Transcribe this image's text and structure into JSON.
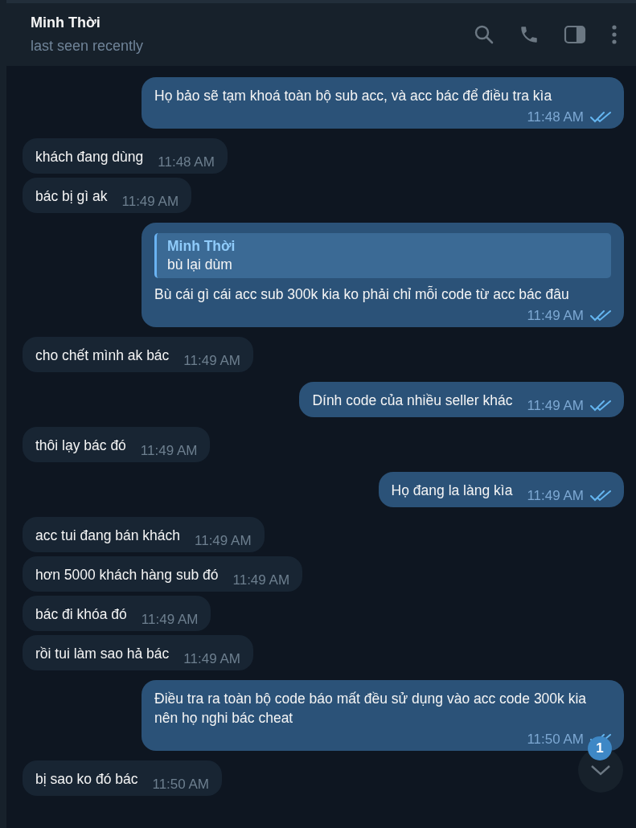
{
  "header": {
    "name": "Minh Thời",
    "status": "last seen recently"
  },
  "messages": [
    {
      "kind": "outgoing",
      "text": "Họ bảo sẽ tạm khoá toàn bộ sub acc, và acc bác để điều tra kìa",
      "time": "11:48 AM",
      "read": true
    },
    {
      "kind": "incoming",
      "text": "khách đang dùng",
      "time": "11:48 AM"
    },
    {
      "kind": "incoming",
      "text": "bác bị gì ak",
      "time": "11:49 AM"
    },
    {
      "kind": "outgoing",
      "reply": {
        "author": "Minh Thời",
        "text": "bù lại dùm"
      },
      "text": "Bù cái gì cái acc sub 300k kia ko phải chỉ mỗi code từ acc bác đâu",
      "time": "11:49 AM",
      "read": true
    },
    {
      "kind": "incoming",
      "text": "cho chết mình ak bác",
      "time": "11:49 AM"
    },
    {
      "kind": "outgoing",
      "text": "Dính code của nhiều seller khác",
      "time": "11:49 AM",
      "read": true
    },
    {
      "kind": "incoming",
      "text": "thôi lạy bác đó",
      "time": "11:49 AM"
    },
    {
      "kind": "outgoing",
      "text": "Họ đang la làng kìa",
      "time": "11:49 AM",
      "read": true
    },
    {
      "kind": "incoming",
      "text": "acc tui đang bán khách",
      "time": "11:49 AM"
    },
    {
      "kind": "incoming",
      "text": "hơn 5000 khách hàng sub đó",
      "time": "11:49 AM"
    },
    {
      "kind": "incoming",
      "text": "bác đi khóa đó",
      "time": "11:49 AM"
    },
    {
      "kind": "incoming",
      "text": "rồi tui làm sao hả bác",
      "time": "11:49 AM"
    },
    {
      "kind": "outgoing",
      "text": "Điều tra ra toàn bộ code báo mất đều sử dụng vào acc code 300k kia nên họ nghi bác cheat",
      "time": "11:50 AM",
      "read": true
    },
    {
      "kind": "incoming",
      "text": "bị sao ko đó bác",
      "time": "11:50 AM"
    }
  ],
  "scroll_button": {
    "badge": "1"
  }
}
